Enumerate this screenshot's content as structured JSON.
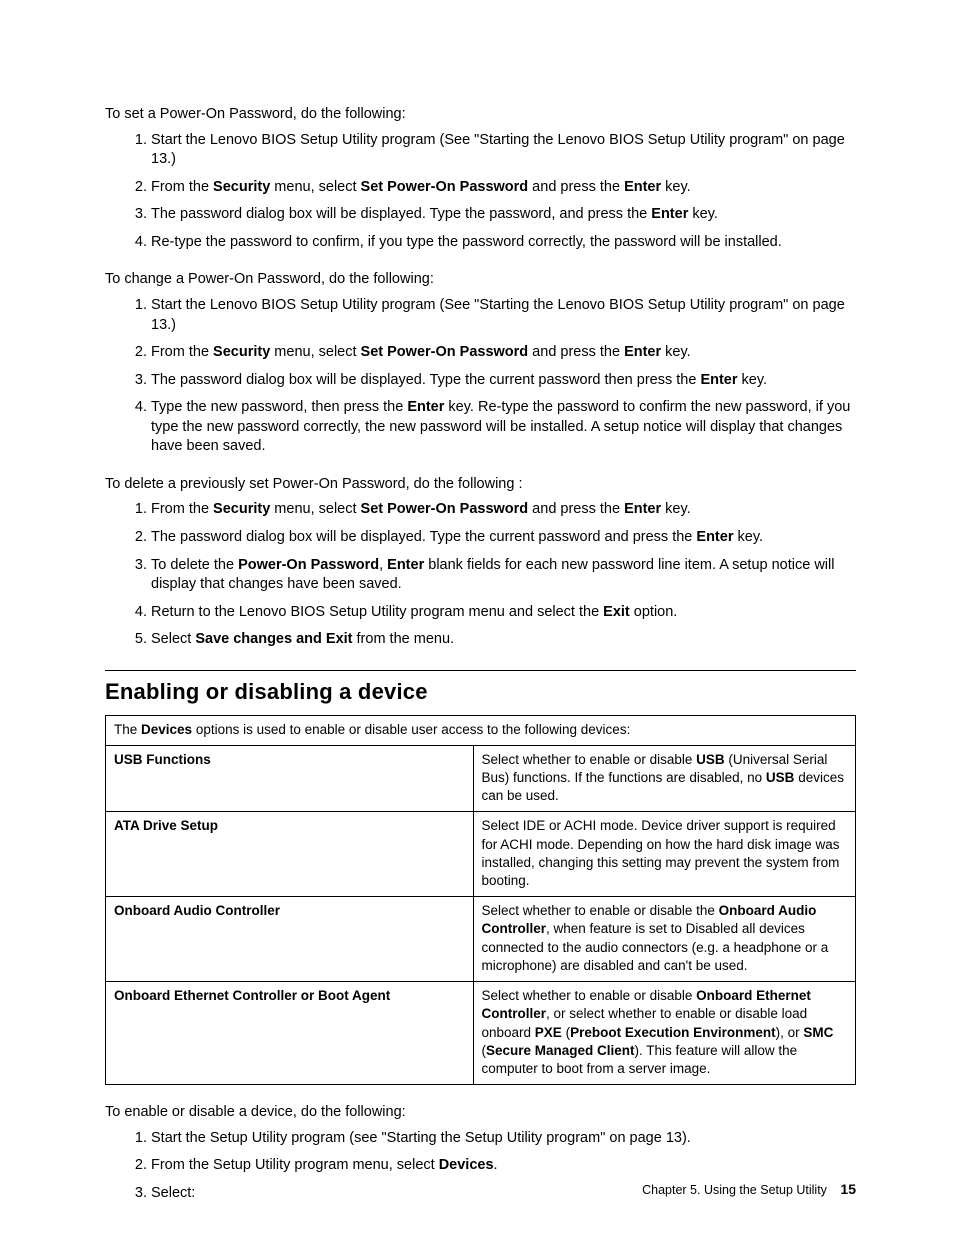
{
  "section1": {
    "intro": "To set a Power-On Password, do the following:",
    "steps": [
      [
        {
          "t": "Start the Lenovo BIOS Setup Utility program (See \"Starting the Lenovo BIOS Setup Utility program\" on page 13.)"
        }
      ],
      [
        {
          "t": "From the "
        },
        {
          "b": "Security"
        },
        {
          "t": " menu, select "
        },
        {
          "b": "Set Power-On Password"
        },
        {
          "t": " and press the "
        },
        {
          "b": "Enter"
        },
        {
          "t": " key."
        }
      ],
      [
        {
          "t": "The password dialog box will be displayed. Type the password, and press the "
        },
        {
          "b": "Enter"
        },
        {
          "t": " key."
        }
      ],
      [
        {
          "t": "Re-type the password to confirm, if you type the password correctly, the password will be installed."
        }
      ]
    ]
  },
  "section2": {
    "intro": "To change a Power-On Password, do the following:",
    "steps": [
      [
        {
          "t": "Start the Lenovo BIOS Setup Utility program (See \"Starting the Lenovo BIOS Setup Utility program\" on page 13.)"
        }
      ],
      [
        {
          "t": "From the "
        },
        {
          "b": "Security"
        },
        {
          "t": " menu, select "
        },
        {
          "b": "Set Power-On Password"
        },
        {
          "t": " and press the "
        },
        {
          "b": "Enter"
        },
        {
          "t": " key."
        }
      ],
      [
        {
          "t": "The password dialog box will be displayed. Type the current password then press the "
        },
        {
          "b": "Enter"
        },
        {
          "t": " key."
        }
      ],
      [
        {
          "t": "Type the new password, then press the "
        },
        {
          "b": "Enter"
        },
        {
          "t": " key. Re-type the password to confirm the new password, if you type the new password correctly, the new password will be installed. A setup notice will display that changes have been saved."
        }
      ]
    ]
  },
  "section3": {
    "intro": "To delete a previously set Power-On Password, do the following :",
    "steps": [
      [
        {
          "t": "From the "
        },
        {
          "b": "Security"
        },
        {
          "t": " menu, select "
        },
        {
          "b": "Set Power-On Password"
        },
        {
          "t": " and press the "
        },
        {
          "b": "Enter"
        },
        {
          "t": " key."
        }
      ],
      [
        {
          "t": "The password dialog box will be displayed. Type the current password and press the "
        },
        {
          "b": "Enter"
        },
        {
          "t": " key."
        }
      ],
      [
        {
          "t": "To delete the "
        },
        {
          "b": "Power-On Password"
        },
        {
          "t": ", "
        },
        {
          "b": "Enter"
        },
        {
          "t": " blank fields for each new password line item. A setup notice will display that changes have been saved."
        }
      ],
      [
        {
          "t": "Return to the Lenovo BIOS Setup Utility program menu and select the "
        },
        {
          "b": "Exit"
        },
        {
          "t": " option."
        }
      ],
      [
        {
          "t": "Select "
        },
        {
          "b": "Save changes and Exit"
        },
        {
          "t": " from the menu."
        }
      ]
    ]
  },
  "heading": "Enabling or disabling a device",
  "table": {
    "lead": [
      {
        "t": "The "
      },
      {
        "b": "Devices"
      },
      {
        "t": " options is used to enable or disable user access to the following devices:"
      }
    ],
    "rows": [
      {
        "name": "USB Functions",
        "desc": [
          {
            "t": "Select whether to enable or disable "
          },
          {
            "b": "USB"
          },
          {
            "t": " (Universal Serial Bus) functions. If the functions are disabled, no "
          },
          {
            "b": "USB"
          },
          {
            "t": " devices can be used."
          }
        ]
      },
      {
        "name": "ATA Drive Setup",
        "desc": [
          {
            "t": "Select IDE or ACHI mode. Device driver support is required for ACHI mode. Depending on how the hard disk image was installed, changing this setting may prevent the system from booting."
          }
        ]
      },
      {
        "name": "Onboard Audio Controller",
        "desc": [
          {
            "t": "Select whether to enable or disable the "
          },
          {
            "b": "Onboard Audio Controller"
          },
          {
            "t": ", when feature is set to Disabled all devices connected to the audio connectors (e.g. a headphone or a microphone) are disabled and can't be used."
          }
        ]
      },
      {
        "name": "Onboard Ethernet Controller or Boot Agent",
        "desc": [
          {
            "t": "Select whether to enable or disable "
          },
          {
            "b": "Onboard Ethernet Controller"
          },
          {
            "t": ", or select whether to enable or disable load onboard "
          },
          {
            "b": "PXE"
          },
          {
            "t": " ("
          },
          {
            "b": "Preboot Execution Environment"
          },
          {
            "t": "), or "
          },
          {
            "b": "SMC"
          },
          {
            "t": " ("
          },
          {
            "b": "Secure Managed Client"
          },
          {
            "t": "). This feature will allow the computer to boot from a server image."
          }
        ]
      }
    ]
  },
  "section4": {
    "intro": "To enable or disable a device, do the following:",
    "steps": [
      [
        {
          "t": "Start the Setup Utility program (see \"Starting the Setup Utility program\" on page 13)."
        }
      ],
      [
        {
          "t": "From the Setup Utility program menu, select "
        },
        {
          "b": "Devices"
        },
        {
          "t": "."
        }
      ],
      [
        {
          "t": "Select:"
        }
      ]
    ]
  },
  "footer": {
    "chapter": "Chapter 5. Using the Setup Utility",
    "page": "15"
  }
}
